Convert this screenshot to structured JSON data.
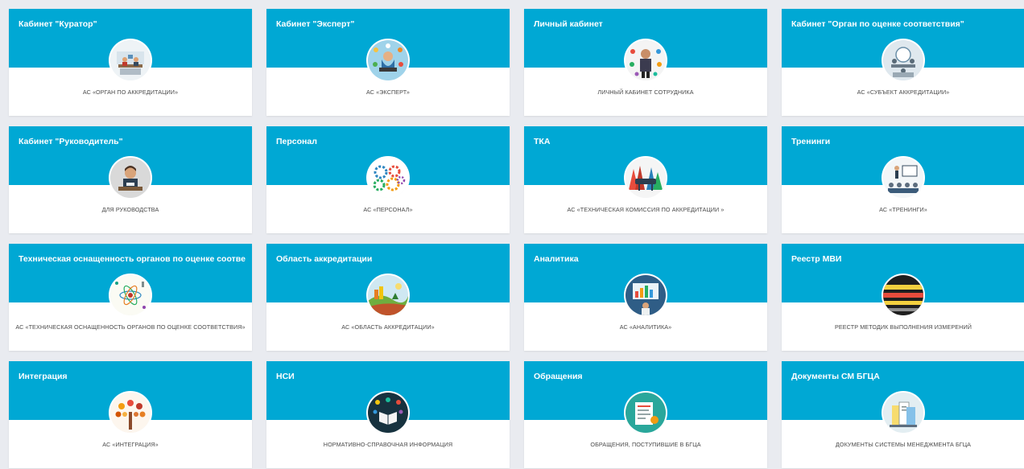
{
  "cards": [
    {
      "title": "Кабинет \"Куратор\"",
      "subtitle": "АС «ОРГАН ПО АККРЕДИТАЦИИ»",
      "icon": "curator-office-icon"
    },
    {
      "title": "Кабинет \"Эксперт\"",
      "subtitle": "АС «ЭКСПЕРТ»",
      "icon": "expert-icon"
    },
    {
      "title": "Личный кабинет",
      "subtitle": "ЛИЧНЫЙ КАБИНЕТ СОТРУДНИКА",
      "icon": "personal-account-icon"
    },
    {
      "title": "Кабинет \"Орган по оценке соответствия\"",
      "subtitle": "АС «СУБЪЕКТ АККРЕДИТАЦИИ»",
      "icon": "conformity-body-icon"
    },
    {
      "title": "Кабинет \"Руководитель\"",
      "subtitle": "ДЛЯ РУКОВОДСТВА",
      "icon": "manager-icon"
    },
    {
      "title": "Персонал",
      "subtitle": "АС «ПЕРСОНАЛ»",
      "icon": "personnel-gears-icon"
    },
    {
      "title": "ТКА",
      "subtitle": "АС «ТЕХНИЧЕСКАЯ КОМИССИЯ ПО АККРЕДИТАЦИИ »",
      "icon": "commission-meeting-icon"
    },
    {
      "title": "Тренинги",
      "subtitle": "АС «ТРЕНИНГИ»",
      "icon": "training-icon"
    },
    {
      "title": "Техническая оснащенность органов по оценке соответствия",
      "subtitle": "АС «ТЕХНИЧЕСКАЯ ОСНАЩЕННОСТЬ ОРГАНОВ ПО ОЦЕНКЕ СООТВЕТСТВИЯ»",
      "icon": "science-atom-icon"
    },
    {
      "title": "Область аккредитации",
      "subtitle": "АС «ОБЛАСТЬ АККРЕДИТАЦИИ»",
      "icon": "landscape-icon"
    },
    {
      "title": "Аналитика",
      "subtitle": "АС «АНАЛИТИКА»",
      "icon": "analytics-monitor-icon"
    },
    {
      "title": "Реестр МВИ",
      "subtitle": "РЕЕСТР МЕТОДИК ВЫПОЛНЕНИЯ ИЗМЕРЕНИЙ",
      "icon": "measurement-registry-icon"
    },
    {
      "title": "Интеграция",
      "subtitle": "АС «ИНТЕГРАЦИЯ»",
      "icon": "integration-tree-icon"
    },
    {
      "title": "НСИ",
      "subtitle": "НОРМАТИВНО-СПРАВОЧНАЯ ИНФОРМАЦИЯ",
      "icon": "reference-book-icon"
    },
    {
      "title": "Обращения",
      "subtitle": "ОБРАЩЕНИЯ, ПОСТУПИВШИЕ В БГЦА",
      "icon": "appeals-documents-icon"
    },
    {
      "title": "Документы СМ БГЦА",
      "subtitle": "ДОКУМЕНТЫ СИСТЕМЫ МЕНЕДЖМЕНТА БГЦА",
      "icon": "management-documents-icon"
    }
  ],
  "colors": {
    "header": "#00a8d4",
    "background": "#e9ebf0",
    "card": "#ffffff",
    "subtitle_text": "#4a4a4a"
  }
}
